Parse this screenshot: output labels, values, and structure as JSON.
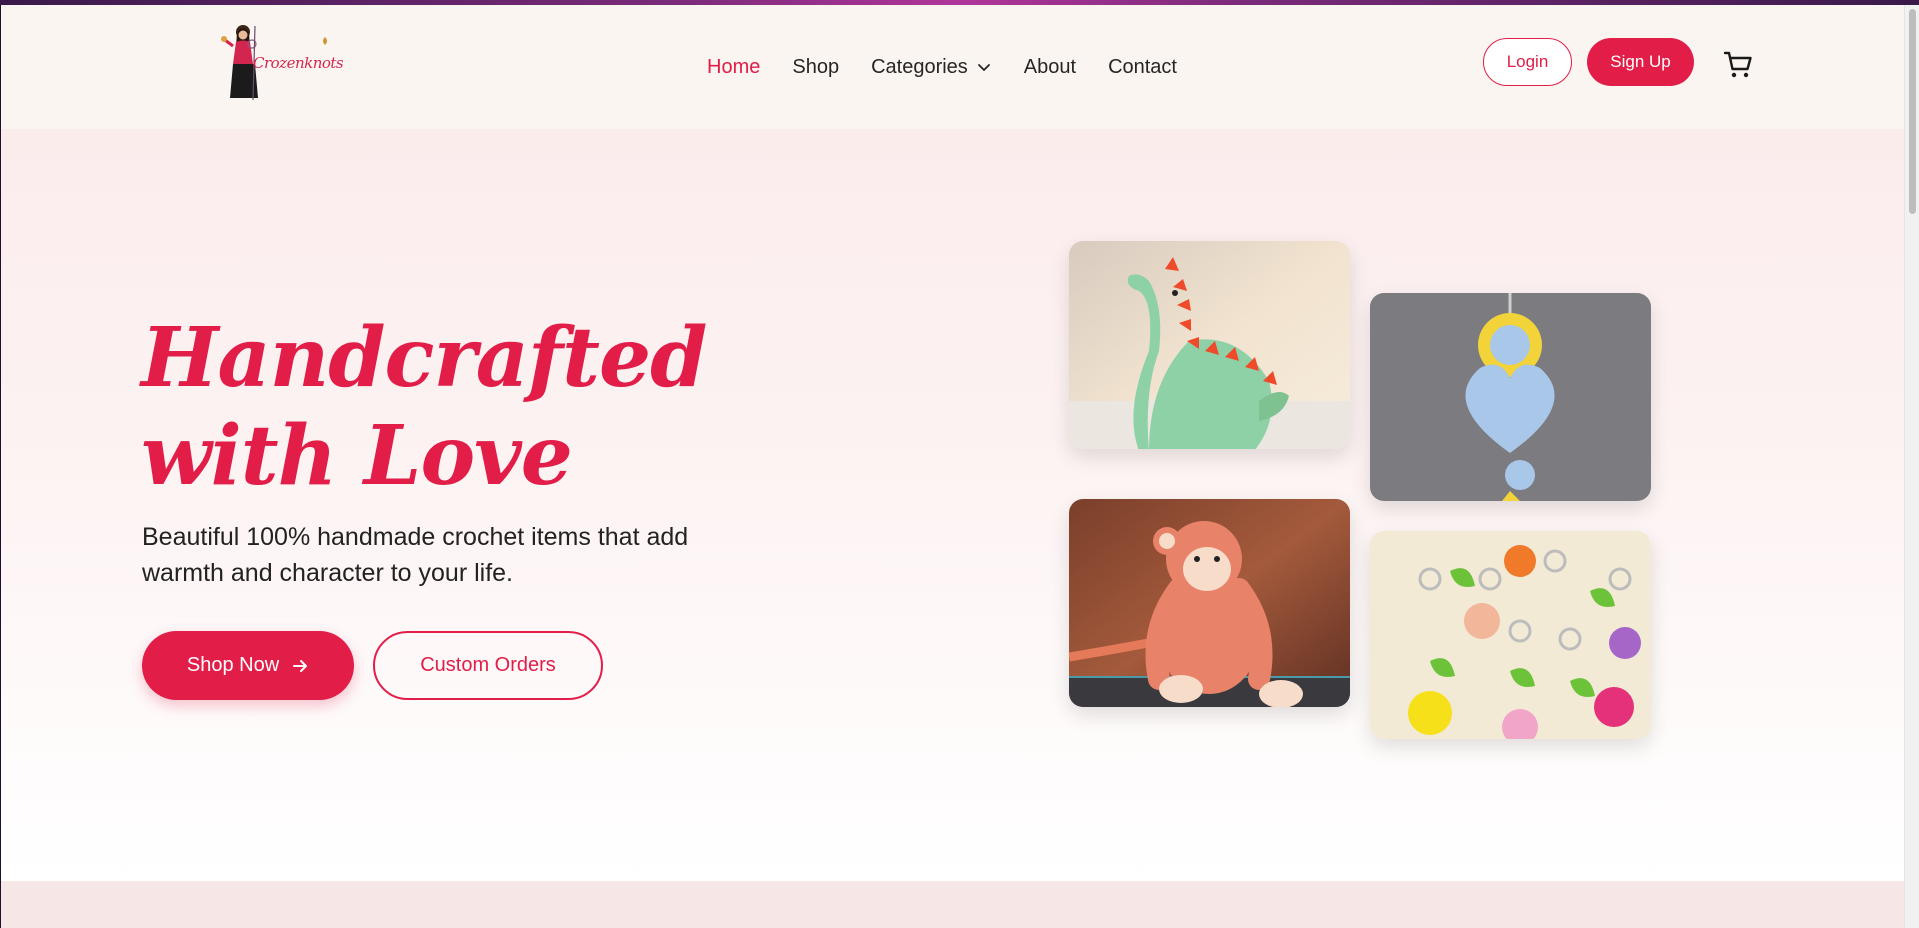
{
  "brand": {
    "logo_text": "Crozenknots",
    "accent_color": "#e11d48"
  },
  "nav": {
    "items": [
      {
        "label": "Home",
        "active": true
      },
      {
        "label": "Shop",
        "active": false
      },
      {
        "label": "Categories",
        "active": false,
        "has_dropdown": true
      },
      {
        "label": "About",
        "active": false
      },
      {
        "label": "Contact",
        "active": false
      }
    ]
  },
  "auth": {
    "login_label": "Login",
    "signup_label": "Sign Up"
  },
  "cart": {
    "icon": "cart-icon"
  },
  "hero": {
    "title_line1": "Handcrafted",
    "title_line2": "with Love",
    "subtitle": "Beautiful 100% handmade crochet items that add warmth and character to your life.",
    "shop_now_label": "Shop Now",
    "custom_orders_label": "Custom Orders"
  },
  "gallery": [
    {
      "subject": "green crochet dinosaur"
    },
    {
      "subject": "blue heart and yellow flower keychain"
    },
    {
      "subject": "orange crochet monkey"
    },
    {
      "subject": "colorful tulip keychains"
    }
  ]
}
